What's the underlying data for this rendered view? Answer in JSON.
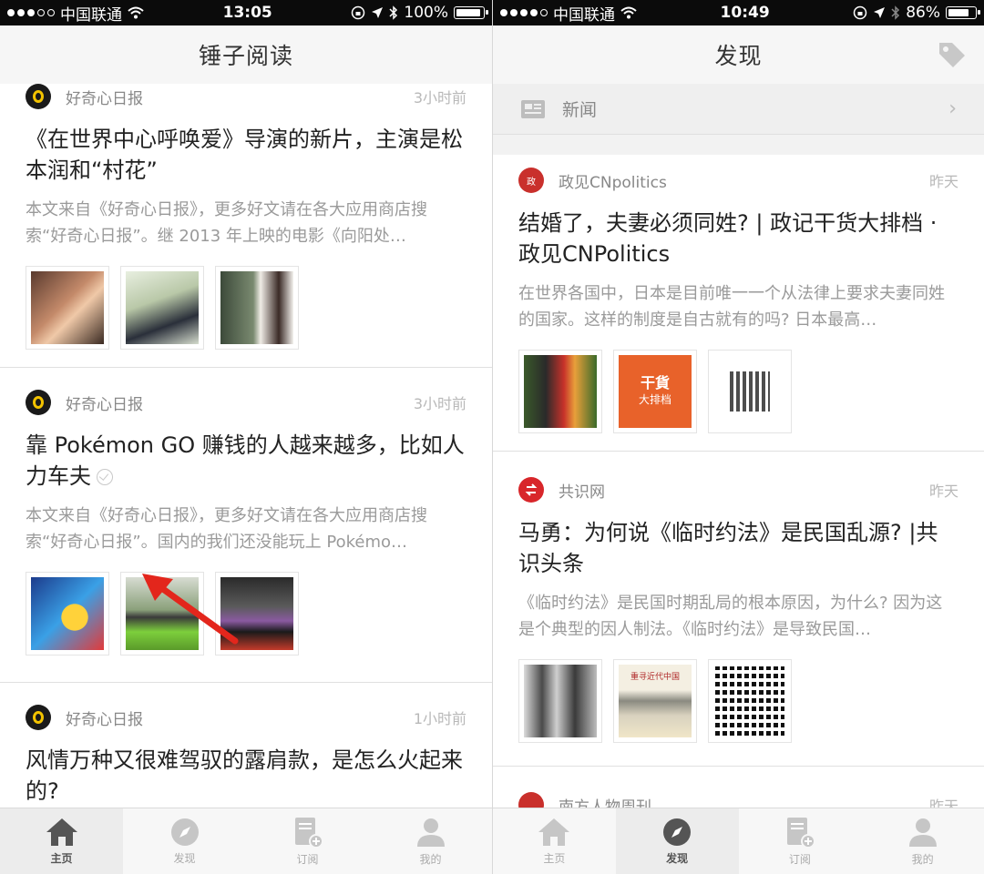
{
  "left_phone": {
    "status": {
      "carrier": "中国联通",
      "time": "13:05",
      "battery": "100%",
      "battery_level": 1.0
    },
    "title": "锤子阅读",
    "articles": [
      {
        "source": "好奇心日报",
        "time": "3小时前",
        "headline": "《在世界中心呼唤爱》导演的新片，主演是松本润和“村花”",
        "summary": "本文来自《好奇心日报》，更多好文请在各大应用商店搜索“好奇心日报”。继 2013 年上映的电影《向阳处…"
      },
      {
        "source": "好奇心日报",
        "time": "3小时前",
        "headline": "靠 Pokémon GO 赚钱的人越来越多，比如人力车夫",
        "summary": "本文来自《好奇心日报》，更多好文请在各大应用商店搜索“好奇心日报”。国内的我们还没能玩上 Pokémo…"
      },
      {
        "source": "好奇心日报",
        "time": "1小时前",
        "headline": "风情万种又很难驾驭的露肩款，是怎么火起来的?"
      }
    ],
    "tabs": [
      {
        "label": "主页",
        "icon": "home-icon",
        "active": true
      },
      {
        "label": "发现",
        "icon": "compass-icon",
        "active": false
      },
      {
        "label": "订阅",
        "icon": "subscribe-icon",
        "active": false
      },
      {
        "label": "我的",
        "icon": "user-icon",
        "active": false
      }
    ]
  },
  "right_phone": {
    "status": {
      "carrier": "中国联通",
      "time": "10:49",
      "battery": "86%",
      "battery_level": 0.86
    },
    "title": "发现",
    "section": {
      "label": "新闻"
    },
    "articles": [
      {
        "source": "政见CNpolitics",
        "time": "昨天",
        "headline": "结婚了，夫妻必须同姓? | 政记干货大排档 · 政见CNPolitics",
        "summary": "在世界各国中，日本是目前唯一一个从法律上要求夫妻同姓的国家。这样的制度是自古就有的吗? 日本最高…",
        "thumb_texts": [
          "干貨",
          "大排档"
        ]
      },
      {
        "source": "共识网",
        "time": "昨天",
        "headline": "马勇：为何说《临时约法》是民国乱源? |共识头条",
        "summary": "《临时约法》是民国时期乱局的根本原因，为什么? 因为这是个典型的因人制法。《临时约法》是导致民国…",
        "thumb_texts": [
          "重寻近代中国"
        ]
      },
      {
        "source": "南方人物周刊",
        "time": "昨天"
      }
    ],
    "tabs": [
      {
        "label": "主页",
        "icon": "home-icon",
        "active": false
      },
      {
        "label": "发现",
        "icon": "compass-icon",
        "active": true
      },
      {
        "label": "订阅",
        "icon": "subscribe-icon",
        "active": false
      },
      {
        "label": "我的",
        "icon": "user-icon",
        "active": false
      }
    ]
  },
  "colors": {
    "accent_red": "#c9302c",
    "logo_yellow": "#f3c300"
  }
}
